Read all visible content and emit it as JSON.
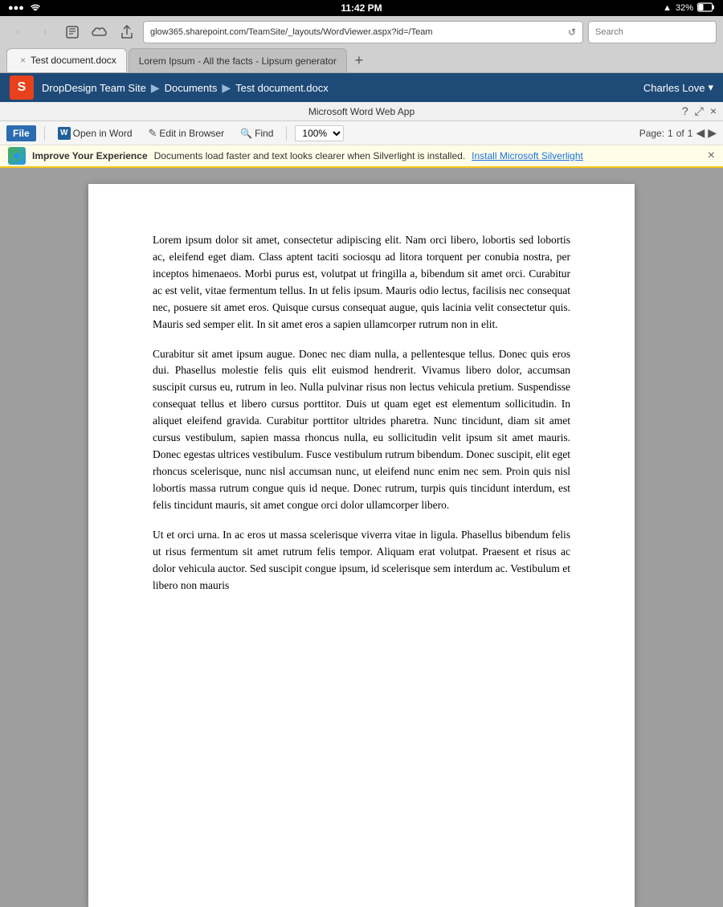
{
  "status_bar": {
    "signal": "3",
    "wifi": "wifi",
    "time": "11:42 PM",
    "battery_pct": "32%",
    "navigation_icon": "✈"
  },
  "browser": {
    "back_btn": "‹",
    "forward_btn": "›",
    "bookmarks_icon": "□",
    "cloud_icon": "☁",
    "share_icon": "⬆",
    "address": "glow365.sharepoint.com/TeamSite/_layouts/WordViewer.aspx?id=/Team",
    "reload_icon": "↺",
    "search_placeholder": "Search",
    "new_tab_icon": "+"
  },
  "tabs": [
    {
      "label": "Test document.docx",
      "active": true,
      "close": "×"
    },
    {
      "label": "Lorem Ipsum - All the facts - Lipsum generator",
      "active": false,
      "close": ""
    }
  ],
  "sharepoint": {
    "logo": "S",
    "site_name": "DropDesign Team Site",
    "sep1": "▶",
    "section": "Documents",
    "sep2": "▶",
    "page": "Test document.docx",
    "user": "Charles Love",
    "user_arrow": "▾"
  },
  "word_app": {
    "title": "Microsoft Word Web App",
    "help_icon": "?",
    "fullscreen_icon": "⤢",
    "close_icon": "×"
  },
  "toolbar": {
    "file_label": "File",
    "open_in_word_icon": "W",
    "open_in_word_label": "Open in Word",
    "edit_in_browser_icon": "✎",
    "edit_in_browser_label": "Edit in Browser",
    "find_icon": "🔍",
    "find_label": "Find",
    "zoom_value": "100%",
    "zoom_dropdown": "▾",
    "page_label": "Page:",
    "page_current": "1",
    "page_sep": "of",
    "page_total": "1",
    "prev_page": "◀",
    "next_page": "▶"
  },
  "banner": {
    "icon_text": "✦",
    "bold_text": "Improve Your Experience",
    "message": "Documents load faster and text looks clearer when Silverlight is installed.",
    "link_text": "Install Microsoft Silverlight",
    "close_icon": "×"
  },
  "document": {
    "paragraphs": [
      "Lorem ipsum dolor sit amet, consectetur adipiscing elit. Nam orci libero, lobortis sed lobortis ac, eleifend eget diam. Class aptent taciti sociosqu ad litora torquent per conubia nostra, per inceptos himenaeos. Morbi purus est, volutpat ut fringilla a, bibendum sit amet orci. Curabitur ac est velit, vitae fermentum tellus. In ut felis ipsum. Mauris odio lectus, facilisis nec consequat nec, posuere sit amet eros. Quisque cursus consequat augue, quis lacinia velit consectetur quis. Mauris sed semper elit. In sit amet eros a sapien ullamcorper rutrum non in elit.",
      "Curabitur sit amet ipsum augue. Donec nec diam nulla, a pellentesque tellus. Donec quis eros dui. Phasellus molestie felis quis elit euismod hendrerit. Vivamus libero dolor, accumsan suscipit cursus eu, rutrum in leo. Nulla pulvinar risus non lectus vehicula pretium. Suspendisse consequat tellus et libero cursus porttitor. Duis ut quam eget est elementum sollicitudin. In aliquet eleifend gravida. Curabitur porttitor ultrides pharetra. Nunc tincidunt, diam sit amet cursus vestibulum, sapien massa rhoncus nulla, eu sollicitudin velit ipsum sit amet mauris. Donec egestas ultrices vestibulum. Fusce vestibulum rutrum bibendum. Donec suscipit, elit eget rhoncus scelerisque, nunc nisl accumsan nunc, ut eleifend nunc enim nec sem. Proin quis nisl lobortis massa rutrum congue quis id neque. Donec rutrum, turpis quis tincidunt interdum, est felis tincidunt mauris, sit amet congue orci dolor ullamcorper libero.",
      "Ut et orci urna. In ac eros ut massa scelerisque viverra vitae in ligula. Phasellus bibendum felis ut risus fermentum sit amet rutrum felis tempor. Aliquam erat volutpat. Praesent et risus ac dolor vehicula auctor. Sed suscipit congue ipsum, id scelerisque sem interdum ac. Vestibulum et libero non mauris"
    ]
  }
}
